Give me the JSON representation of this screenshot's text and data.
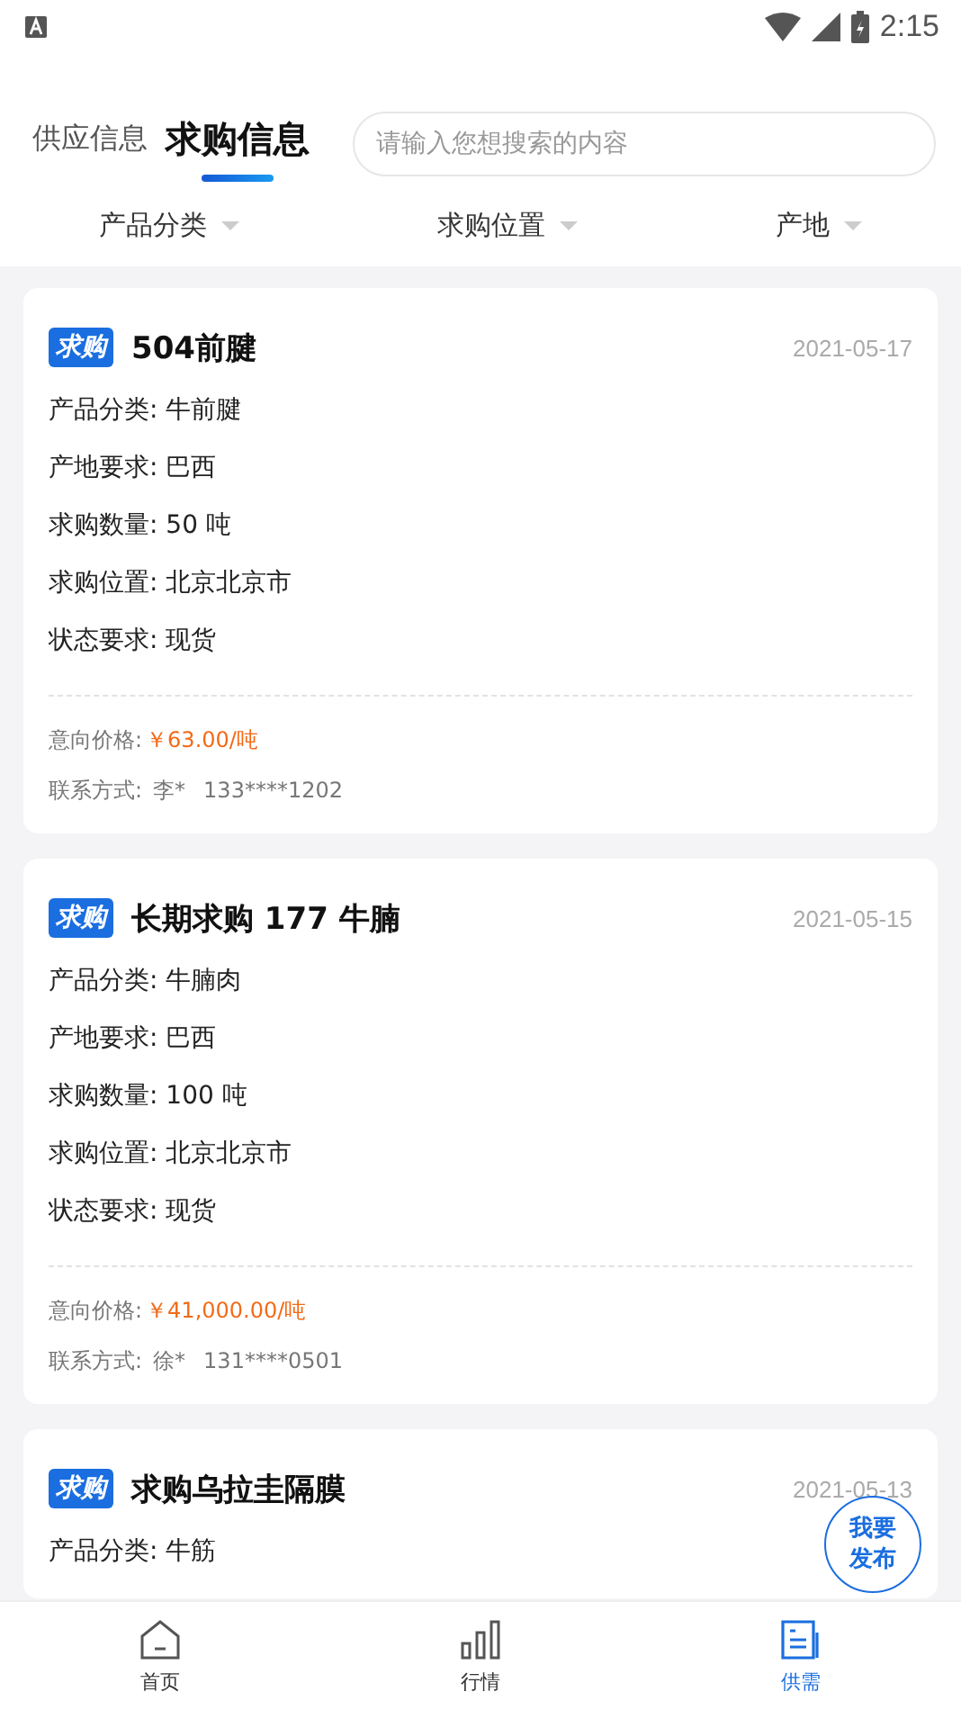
{
  "status_bar": {
    "time": "2:15"
  },
  "tabs": [
    {
      "label": "供应信息",
      "selected": false
    },
    {
      "label": "求购信息",
      "selected": true
    }
  ],
  "search": {
    "placeholder": "请输入您想搜索的内容"
  },
  "filters": [
    "产品分类",
    "求购位置",
    "产地"
  ],
  "cards": [
    {
      "badge": "求购",
      "title": "504前腱",
      "date": "2021-05-17",
      "fields": [
        "产品分类: 牛前腱",
        "产地要求: 巴西",
        "求购数量: 50  吨",
        "求购位置: 北京北京市",
        "状态要求: 现货"
      ],
      "price_label": "意向价格:",
      "price": "￥63.00/吨",
      "contact_label": "联系方式:",
      "contact_name": "李*",
      "contact_phone": "133****1202"
    },
    {
      "badge": "求购",
      "title": "长期求购 177 牛腩",
      "date": "2021-05-15",
      "fields": [
        "产品分类: 牛腩肉",
        "产地要求: 巴西",
        "求购数量: 100  吨",
        "求购位置: 北京北京市",
        "状态要求: 现货"
      ],
      "price_label": "意向价格:",
      "price": "￥41,000.00/吨",
      "contact_label": "联系方式:",
      "contact_name": "徐*",
      "contact_phone": "131****0501"
    },
    {
      "badge": "求购",
      "title": "求购乌拉圭隔膜",
      "date": "2021-05-13",
      "fields": [
        "产品分类: 牛筋"
      ]
    }
  ],
  "fab": {
    "line1": "我要",
    "line2": "发布"
  },
  "nav": [
    {
      "label": "首页",
      "kind": "home",
      "selected": false
    },
    {
      "label": "行情",
      "kind": "chart",
      "selected": false
    },
    {
      "label": "供需",
      "kind": "doc",
      "selected": true
    }
  ]
}
